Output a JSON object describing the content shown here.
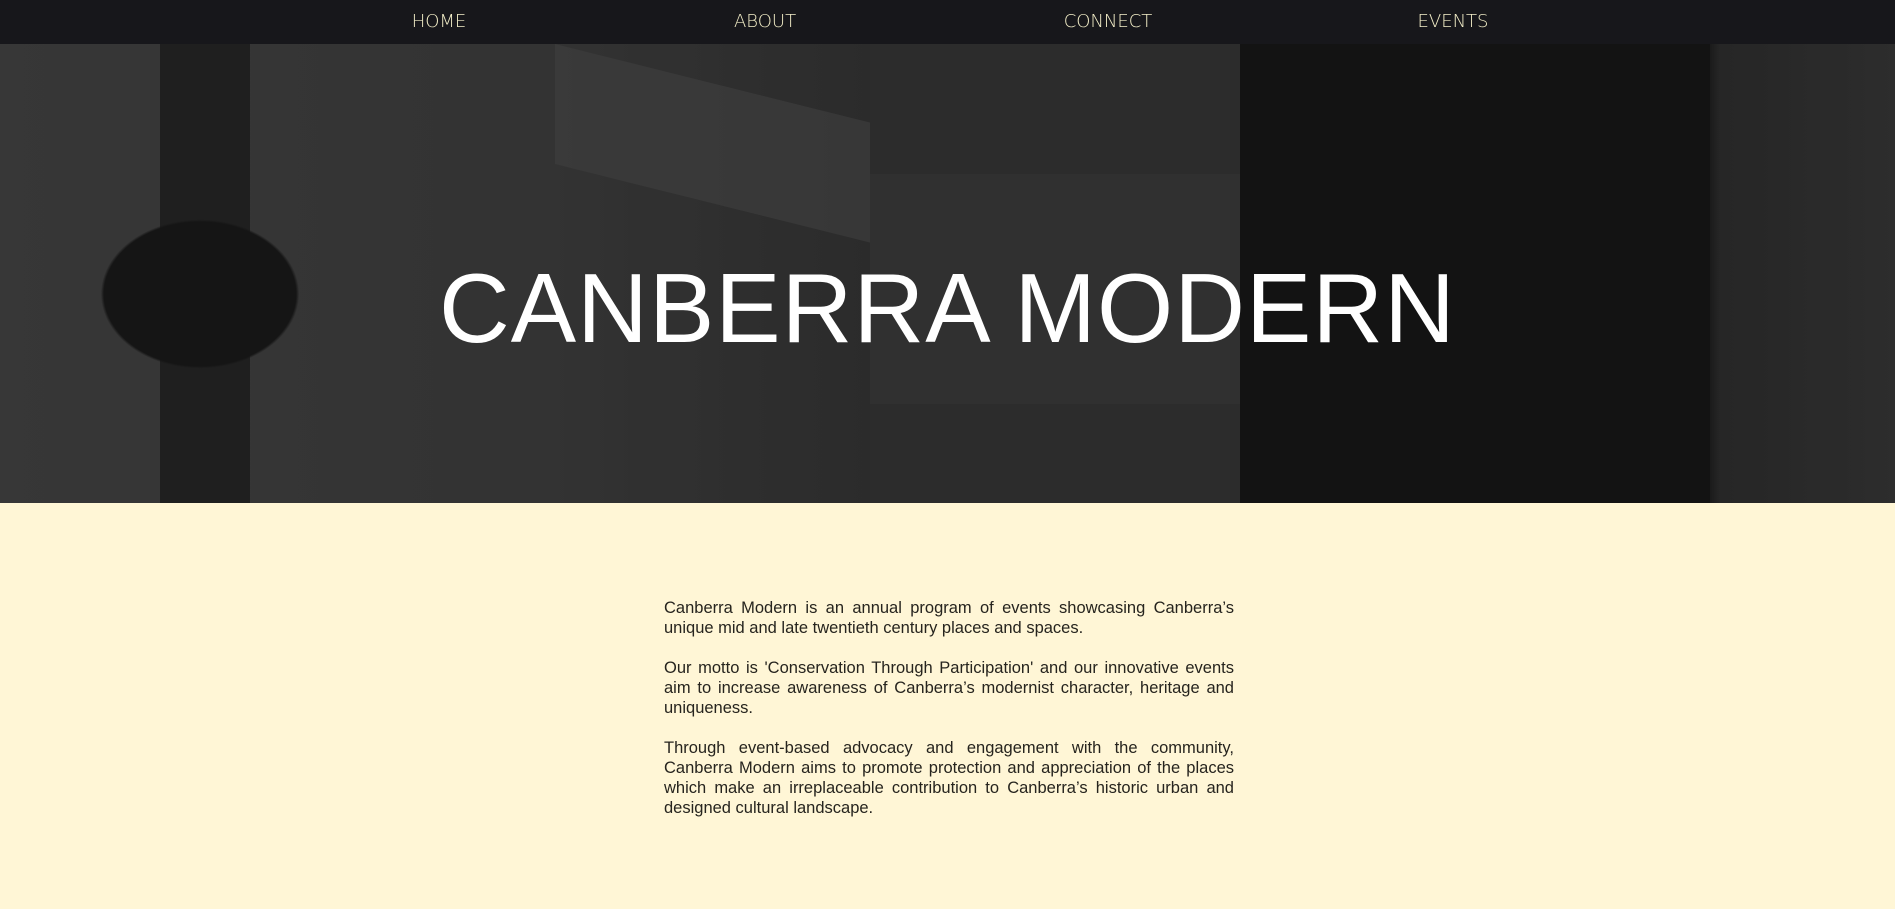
{
  "nav": {
    "items": [
      {
        "label": "HOME"
      },
      {
        "label": "ABOUT"
      },
      {
        "label": "CONNECT"
      },
      {
        "label": "EVENTS"
      }
    ]
  },
  "hero": {
    "title": "CANBERRA MODERN"
  },
  "content": {
    "paragraphs": [
      "Canberra Modern is an annual program of events showcasing Canberra’s unique mid and late twentieth century places and spaces.",
      "Our motto is 'Conservation Through Participation' and our innovative events aim to increase awareness of Canberra’s modernist character, heritage and uniqueness.",
      "Through event-based advocacy and engagement with the community, Canberra Modern aims to promote protection and appreciation of the places which make an irreplaceable contribution to Canberra’s historic urban and designed cultural landscape."
    ]
  },
  "colors": {
    "nav_bg": "#17171b",
    "nav_text": "#f3eec8",
    "page_bg": "#fff6d6"
  }
}
